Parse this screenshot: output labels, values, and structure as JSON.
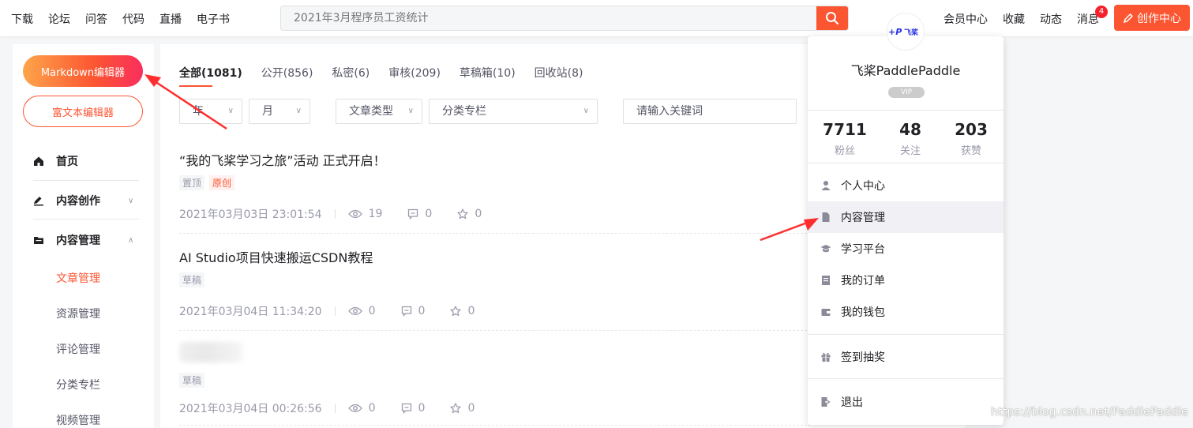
{
  "topnav": [
    "下载",
    "论坛",
    "问答",
    "代码",
    "直播",
    "电子书"
  ],
  "search": {
    "placeholder": "2021年3月程序员工资统计"
  },
  "topright": [
    "会员中心",
    "收藏",
    "动态",
    "消息"
  ],
  "message_badge": "4",
  "create_center": "创作中心",
  "sidebar": {
    "markdown_btn": "Markdown编辑器",
    "richtext_btn": "富文本编辑器",
    "home": "首页",
    "content_create": "内容创作",
    "content_manage": "内容管理",
    "subitems": [
      "文章管理",
      "资源管理",
      "评论管理",
      "分类专栏",
      "视频管理"
    ]
  },
  "tabs": [
    "全部(1081)",
    "公开(856)",
    "私密(6)",
    "审核(209)",
    "草稿箱(10)",
    "回收站(8)"
  ],
  "filters": {
    "year": "年",
    "month": "月",
    "type": "文章类型",
    "column": "分类专栏",
    "keyword_placeholder": "请输入关键词"
  },
  "articles": [
    {
      "title": "“我的飞桨学习之旅”活动 正式开启！",
      "tags": [
        "置顶",
        "原创"
      ],
      "date": "2021年03月03日 23:01:54",
      "views": "19",
      "comments": "0",
      "likes": "0"
    },
    {
      "title": "AI Studio项目快速搬运CSDN教程",
      "tags": [
        "草稿"
      ],
      "date": "2021年03月04日 11:34:20",
      "views": "0",
      "comments": "0",
      "likes": "0"
    },
    {
      "title": "",
      "tags": [
        "草稿"
      ],
      "date": "2021年03月04日 00:26:56",
      "views": "0",
      "comments": "0",
      "likes": "0"
    }
  ],
  "panel": {
    "avatar_text": "飞桨",
    "name": "飞桨PaddlePaddle",
    "vip": "VIP",
    "stats": [
      {
        "num": "7711",
        "label": "粉丝"
      },
      {
        "num": "48",
        "label": "关注"
      },
      {
        "num": "203",
        "label": "获赞"
      }
    ],
    "menu": [
      "个人中心",
      "内容管理",
      "学习平台",
      "我的订单",
      "我的钱包"
    ],
    "lottery": "签到抽奖",
    "logout": "退出"
  },
  "watermark": "https://blog.csdn.net/PaddlePaddle",
  "colors": {
    "accent": "#fc5531",
    "text": "#222226",
    "muted": "#999aaa"
  }
}
